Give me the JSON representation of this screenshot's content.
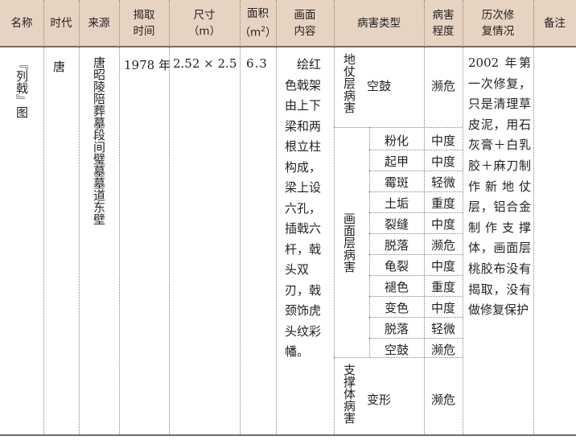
{
  "headers": {
    "name": "名称",
    "era": "时代",
    "source": "来源",
    "uncover_1": "揭取",
    "uncover_2": "时间",
    "size_1": "尺寸",
    "size_2": "（m）",
    "area_1": "面积",
    "area_2": "（m",
    "area_sup": "2",
    "area_3": "）",
    "content_1": "画面",
    "content_2": "内容",
    "disease_type": "病害类型",
    "degree_1": "病害",
    "degree_2": "程度",
    "history_1": "历次修",
    "history_2": "复情况",
    "remark": "备注"
  },
  "row": {
    "name": "『列戟』图",
    "era": "唐",
    "source": "唐昭陵陪葬墓段间璧墓墓道东壁",
    "uncover": "1978 年",
    "size": "2.52 × 2.5",
    "area": "6.3",
    "content": "　绘红色戟架由上下梁和两根立柱构成，梁上设六孔，插戟六杆，戟头双刃，戟颈饰虎头纹彩幡。",
    "history": "2002 年第一次修复，只是清理草皮泥，用石灰膏＋白乳胶＋麻刀制作新地仗层，铝合金制作支撑体，画面层桃胶布没有揭取，没有做修复保护",
    "remark": ""
  },
  "groups": {
    "ground": "地仗层病害",
    "paint": "画面层病害",
    "support": "支撑体病害"
  },
  "diseases": [
    {
      "type": "空鼓",
      "degree": "濒危"
    },
    {
      "type": "粉化",
      "degree": "中度"
    },
    {
      "type": "起甲",
      "degree": "中度"
    },
    {
      "type": "霉斑",
      "degree": "轻微"
    },
    {
      "type": "土垢",
      "degree": "重度"
    },
    {
      "type": "裂缝",
      "degree": "中度"
    },
    {
      "type": "脱落",
      "degree": "濒危"
    },
    {
      "type": "龟裂",
      "degree": "中度"
    },
    {
      "type": "褪色",
      "degree": "重度"
    },
    {
      "type": "变色",
      "degree": "中度"
    },
    {
      "type": "脱落",
      "degree": "轻微"
    },
    {
      "type": "空鼓",
      "degree": "濒危"
    },
    {
      "type": "变形",
      "degree": "濒危"
    }
  ]
}
